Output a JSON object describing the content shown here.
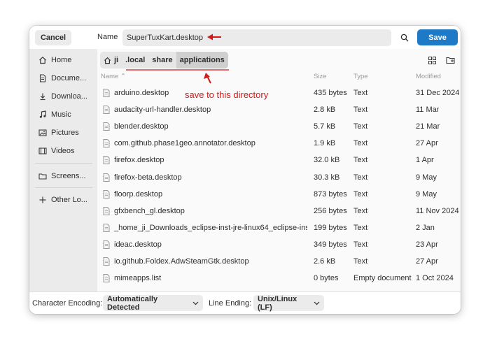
{
  "header": {
    "cancel_label": "Cancel",
    "name_label": "Name",
    "filename": "SuperTuxKart.desktop",
    "save_label": "Save"
  },
  "sidebar": {
    "items": [
      {
        "label": "Home",
        "icon": "home-icon"
      },
      {
        "label": "Docume...",
        "icon": "document-icon"
      },
      {
        "label": "Downloa...",
        "icon": "download-icon"
      },
      {
        "label": "Music",
        "icon": "music-icon"
      },
      {
        "label": "Pictures",
        "icon": "picture-icon"
      },
      {
        "label": "Videos",
        "icon": "video-icon"
      },
      {
        "label": "Screens...",
        "icon": "folder-icon"
      },
      {
        "label": "Other Lo...",
        "icon": "plus-icon"
      }
    ]
  },
  "breadcrumb": [
    "ji",
    ".local",
    "share",
    "applications"
  ],
  "columns": {
    "name": "Name",
    "size": "Size",
    "type": "Type",
    "modified": "Modified"
  },
  "files": [
    {
      "name": "arduino.desktop",
      "size": "435 bytes",
      "type": "Text",
      "modified": "31 Dec 2024"
    },
    {
      "name": "audacity-url-handler.desktop",
      "size": "2.8 kB",
      "type": "Text",
      "modified": "11 Mar"
    },
    {
      "name": "blender.desktop",
      "size": "5.7 kB",
      "type": "Text",
      "modified": "21 Mar"
    },
    {
      "name": "com.github.phase1geo.annotator.desktop",
      "size": "1.9 kB",
      "type": "Text",
      "modified": "27 Apr"
    },
    {
      "name": "firefox.desktop",
      "size": "32.0 kB",
      "type": "Text",
      "modified": "1 Apr"
    },
    {
      "name": "firefox-beta.desktop",
      "size": "30.3 kB",
      "type": "Text",
      "modified": "9 May"
    },
    {
      "name": "floorp.desktop",
      "size": "873 bytes",
      "type": "Text",
      "modified": "9 May"
    },
    {
      "name": "gfxbench_gl.desktop",
      "size": "256 bytes",
      "type": "Text",
      "modified": "11 Nov 2024"
    },
    {
      "name": "_home_ji_Downloads_eclipse-inst-jre-linux64_eclipse-inst",
      "size": "199 bytes",
      "type": "Text",
      "modified": "2 Jan"
    },
    {
      "name": "ideac.desktop",
      "size": "349 bytes",
      "type": "Text",
      "modified": "23 Apr"
    },
    {
      "name": "io.github.Foldex.AdwSteamGtk.desktop",
      "size": "2.6 kB",
      "type": "Text",
      "modified": "27 Apr"
    },
    {
      "name": "mimeapps.list",
      "size": "0 bytes",
      "type": "Empty document",
      "modified": "1 Oct 2024"
    }
  ],
  "footer": {
    "encoding_label": "Character Encoding:",
    "encoding_value": "Automatically Detected",
    "line_ending_label": "Line Ending:",
    "line_ending_value": "Unix/Linux (LF)"
  },
  "annotation": {
    "text": "save to this directory",
    "color": "#d11a1a"
  },
  "colors": {
    "accent": "#1e7ac7"
  }
}
